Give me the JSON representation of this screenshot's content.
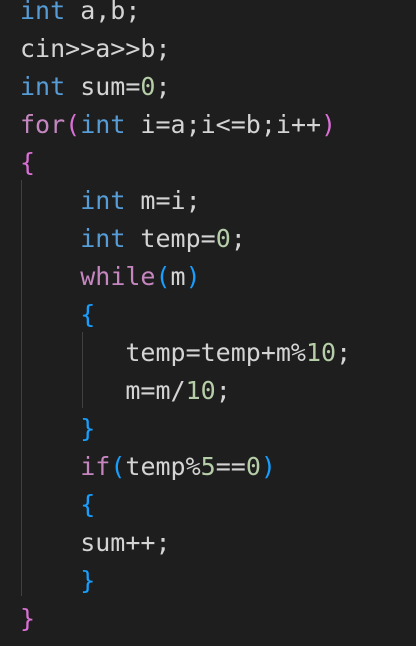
{
  "colors": {
    "background": "#1e1e1e",
    "default_text": "#d4d4d4",
    "keyword_type": "#569cd6",
    "keyword_control": "#c586c0",
    "number": "#b5cea8",
    "bracket_level_1": "#da70d6",
    "bracket_level_2": "#179fff",
    "indent_guide": "#404040"
  },
  "code_lines": [
    [
      {
        "t": "int",
        "c": "kw"
      },
      {
        "t": " a,b;",
        "c": ""
      }
    ],
    [
      {
        "t": "cin>>a>>b;",
        "c": ""
      }
    ],
    [
      {
        "t": "int",
        "c": "kw"
      },
      {
        "t": " sum=",
        "c": ""
      },
      {
        "t": "0",
        "c": "num"
      },
      {
        "t": ";",
        "c": ""
      }
    ],
    [
      {
        "t": "for",
        "c": "ctl"
      },
      {
        "t": "(",
        "c": "bm"
      },
      {
        "t": "int",
        "c": "kw"
      },
      {
        "t": " i=a;i<=b;i++",
        "c": ""
      },
      {
        "t": ")",
        "c": "bm"
      }
    ],
    [
      {
        "t": "{",
        "c": "bm"
      }
    ],
    [
      {
        "t": "    ",
        "c": ""
      },
      {
        "t": "int",
        "c": "kw"
      },
      {
        "t": " m=i;",
        "c": ""
      }
    ],
    [
      {
        "t": "    ",
        "c": ""
      },
      {
        "t": "int",
        "c": "kw"
      },
      {
        "t": " temp=",
        "c": ""
      },
      {
        "t": "0",
        "c": "num"
      },
      {
        "t": ";",
        "c": ""
      }
    ],
    [
      {
        "t": "    ",
        "c": ""
      },
      {
        "t": "while",
        "c": "ctl"
      },
      {
        "t": "(",
        "c": "bb"
      },
      {
        "t": "m",
        "c": ""
      },
      {
        "t": ")",
        "c": "bb"
      }
    ],
    [
      {
        "t": "    ",
        "c": ""
      },
      {
        "t": "{",
        "c": "bb"
      }
    ],
    [
      {
        "t": "       temp=temp+m%",
        "c": ""
      },
      {
        "t": "10",
        "c": "num"
      },
      {
        "t": ";",
        "c": ""
      }
    ],
    [
      {
        "t": "       m=m/",
        "c": ""
      },
      {
        "t": "10",
        "c": "num"
      },
      {
        "t": ";",
        "c": ""
      }
    ],
    [
      {
        "t": "    ",
        "c": ""
      },
      {
        "t": "}",
        "c": "bb"
      }
    ],
    [
      {
        "t": "    ",
        "c": ""
      },
      {
        "t": "if",
        "c": "ctl"
      },
      {
        "t": "(",
        "c": "bb"
      },
      {
        "t": "temp%",
        "c": ""
      },
      {
        "t": "5",
        "c": "num"
      },
      {
        "t": "==",
        "c": ""
      },
      {
        "t": "0",
        "c": "num"
      },
      {
        "t": ")",
        "c": "bb"
      }
    ],
    [
      {
        "t": "    ",
        "c": ""
      },
      {
        "t": "{",
        "c": "bb"
      }
    ],
    [
      {
        "t": "    sum++;",
        "c": ""
      }
    ],
    [
      {
        "t": "    ",
        "c": ""
      },
      {
        "t": "}",
        "c": "bb"
      }
    ],
    [
      {
        "t": "}",
        "c": "bm"
      }
    ]
  ]
}
